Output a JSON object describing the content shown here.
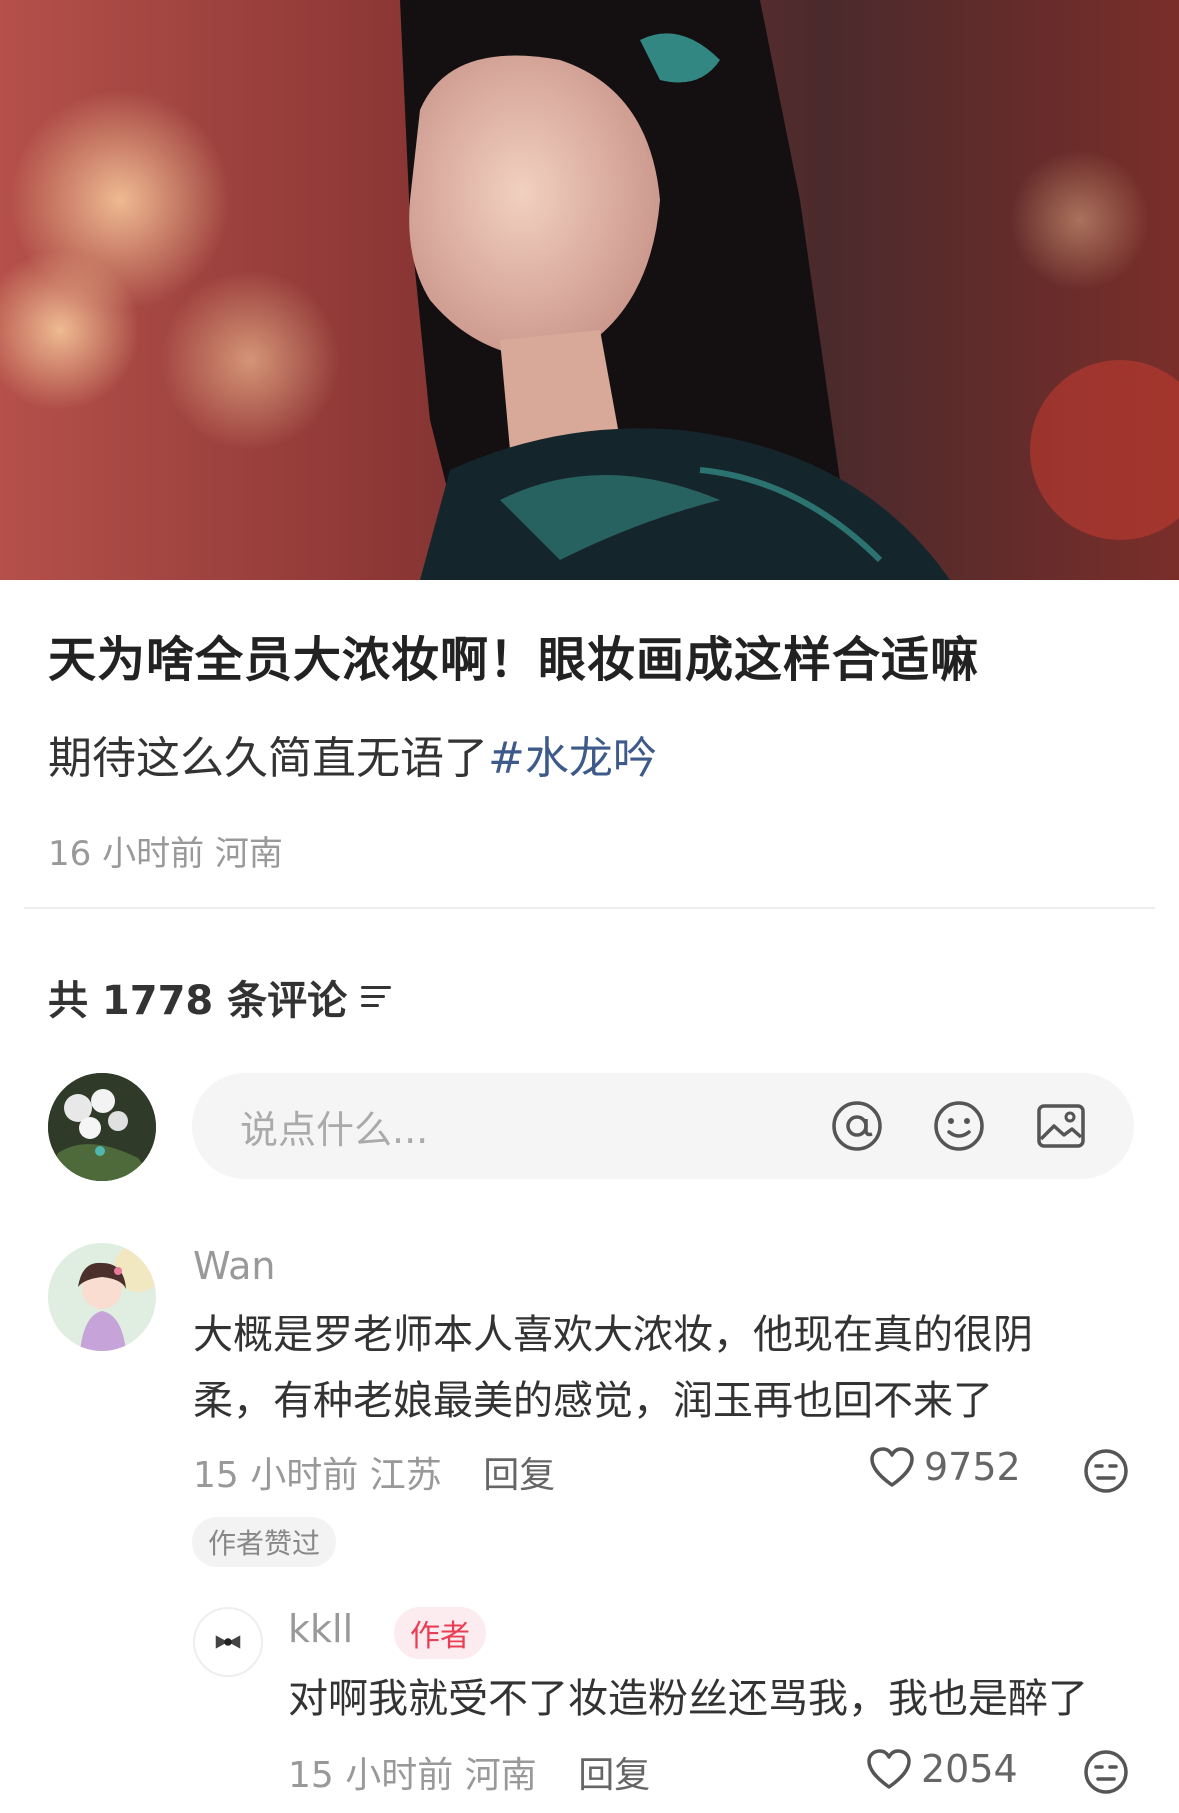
{
  "post": {
    "title": "天为啥全员大浓妆啊！眼妆画成这样合适嘛",
    "body_text": "期待这么久简直无语了",
    "hashtag": "#水龙吟",
    "time": "16 小时前",
    "location": "河南"
  },
  "comments_header": {
    "label": "共 1778 条评论"
  },
  "input": {
    "placeholder": "说点什么..."
  },
  "comments": [
    {
      "user": "Wan",
      "text": "大概是罗老师本人喜欢大浓妆，他现在真的很阴柔，有种老娘最美的感觉，润玉再也回不来了",
      "time": "15 小时前",
      "location": "江苏",
      "reply_label": "回复",
      "likes": "9752",
      "badge": "作者赞过"
    },
    {
      "user": "kkll",
      "author_label": "作者",
      "text": "对啊我就受不了妆造粉丝还骂我，我也是醉了",
      "time": "15 小时前",
      "location": "河南",
      "reply_label": "回复",
      "likes": "2054"
    }
  ],
  "icons": {
    "sort": "sort-lines-icon",
    "at": "at-icon",
    "emoji": "smiley-icon",
    "image": "image-icon",
    "like": "heart-icon",
    "dislike": "neutral-face-icon"
  },
  "colors": {
    "hashtag": "#3d5a8a",
    "author_badge": "#e83f54",
    "meta": "#999999"
  }
}
